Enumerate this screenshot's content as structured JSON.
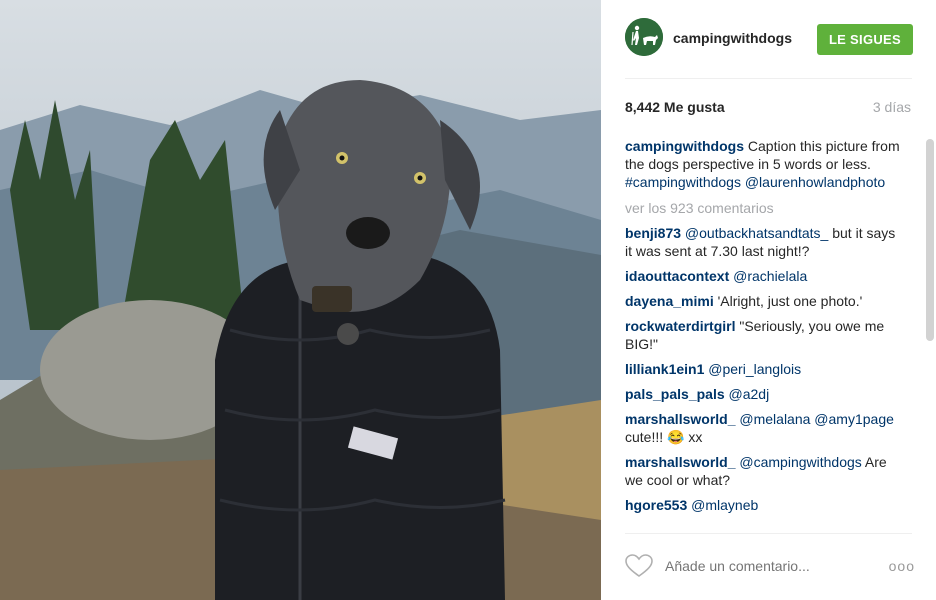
{
  "header": {
    "username": "campingwithdogs",
    "follow_label": "LE SIGUES"
  },
  "stats": {
    "likes": "8,442 Me gusta",
    "time": "3 días"
  },
  "caption": {
    "user": "campingwithdogs",
    "text": " Caption this picture from the dogs perspective in 5 words or less. ",
    "tags": "#campingwithdogs @laurenhowlandphoto"
  },
  "view_all": "ver los 923 comentarios",
  "comments": [
    {
      "user": "benji873",
      "mention": "@outbackhatsandtats_",
      "text": " but it says it was sent at 7.30 last night!?"
    },
    {
      "user": "idaouttacontext",
      "mention": "@rachielala",
      "text": ""
    },
    {
      "user": "dayena_mimi",
      "mention": "",
      "text": "'Alright, just one photo.'"
    },
    {
      "user": "rockwaterdirtgirl",
      "mention": "",
      "text": "\"Seriously, you owe me BIG!\""
    },
    {
      "user": "lilliank1ein1",
      "mention": "@peri_langlois",
      "text": ""
    },
    {
      "user": "pals_pals_pals",
      "mention": "@a2dj",
      "text": ""
    },
    {
      "user": "marshallsworld_",
      "mention": "@melalana @amy1page",
      "text": " cute!!! 😂 xx"
    },
    {
      "user": "marshallsworld_",
      "mention": "@campingwithdogs",
      "text": " Are we cool or what?"
    },
    {
      "user": "hgore553",
      "mention": "@mlayneb",
      "text": ""
    }
  ],
  "footer": {
    "placeholder": "Añade un comentario...",
    "more": "ooo"
  },
  "colors": {
    "follow_green": "#5fb13b",
    "link_blue": "#003569",
    "muted_gray": "#a5a7aa"
  }
}
